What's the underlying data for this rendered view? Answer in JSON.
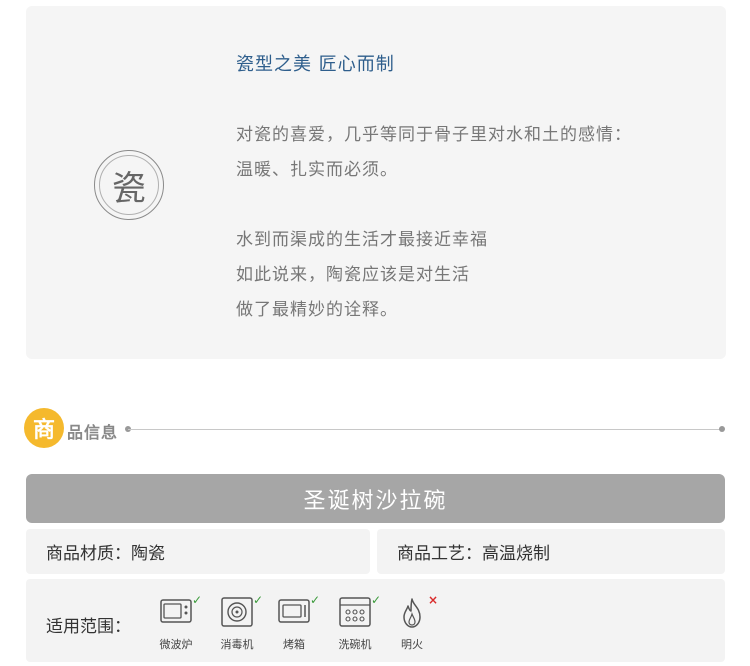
{
  "intro": {
    "seal_char": "瓷",
    "title": "瓷型之美  匠心而制",
    "lines": [
      "对瓷的喜爱，几乎等同于骨子里对水和土的感情：",
      "温暖、扎实而必须。",
      "水到而渠成的生活才最接近幸福",
      "如此说来，陶瓷应该是对生活",
      "做了最精妙的诠释。"
    ]
  },
  "section": {
    "badge": "商",
    "label": "品信息"
  },
  "product": {
    "name": "圣诞树沙拉碗",
    "material": "商品材质：陶瓷",
    "craft": "商品工艺：高温烧制",
    "usage_label": "适用范围：",
    "appliances": [
      {
        "label": "微波炉",
        "icon": "microwave-icon",
        "supported": true,
        "mark": "✓"
      },
      {
        "label": "消毒机",
        "icon": "sterilizer-icon",
        "supported": true,
        "mark": "✓"
      },
      {
        "label": "烤箱",
        "icon": "oven-icon",
        "supported": true,
        "mark": "✓"
      },
      {
        "label": "洗碗机",
        "icon": "dishwasher-icon",
        "supported": true,
        "mark": "✓"
      },
      {
        "label": "明火",
        "icon": "flame-icon",
        "supported": false,
        "mark": "×"
      }
    ]
  },
  "colors": {
    "accent": "#f5b92d",
    "title_blue": "#2e5e8c",
    "bar_gray": "#a6a6a6",
    "ok_green": "#3a9a3a",
    "no_red": "#d92b2b"
  }
}
